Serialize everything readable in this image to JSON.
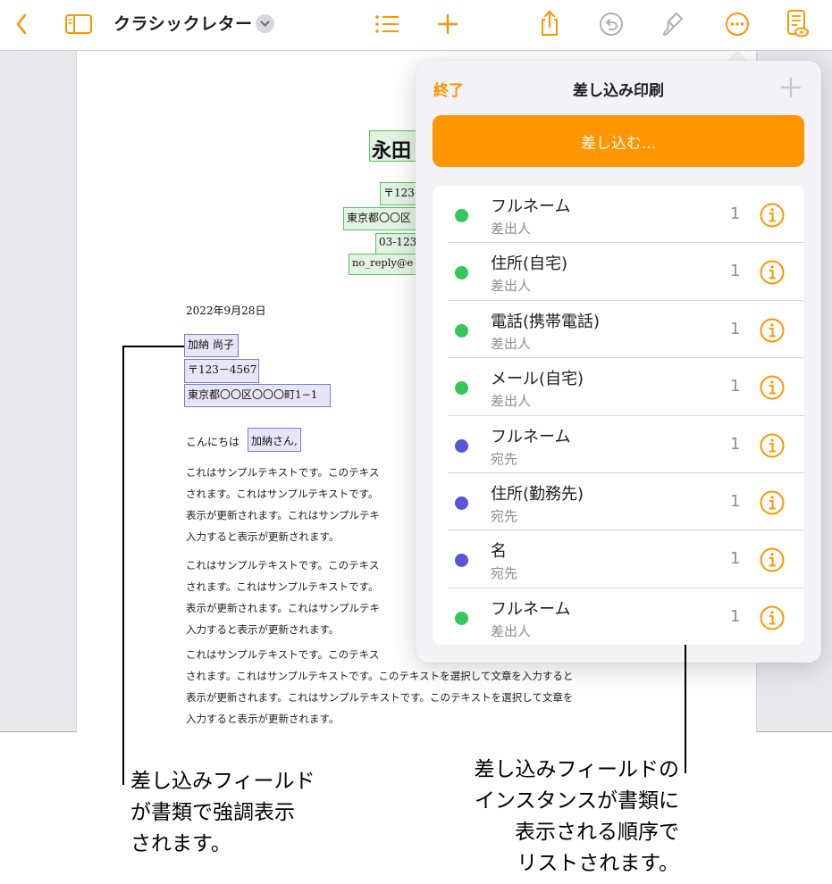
{
  "toolbar": {
    "back_icon": "chevron-left-icon",
    "sidebar_icon": "sidebar-icon",
    "title": "クラシックレター",
    "title_chevron_icon": "chevron-down-icon",
    "list_icon": "list-icon",
    "add_icon": "plus-icon",
    "share_icon": "share-icon",
    "undo_icon": "undo-icon",
    "format_icon": "paintbrush-icon",
    "more_icon": "ellipsis-circle-icon",
    "view_icon": "document-view-icon",
    "accent_color": "#ff9500"
  },
  "document": {
    "sender_name": "永田",
    "sender_postal": "〒123-",
    "sender_address": "東京都〇〇区",
    "sender_phone": "03-123",
    "sender_email": "no_reply@e",
    "date": "2022年9月28日",
    "recipient_name": "加納 尚子",
    "recipient_postal": "〒123－4567",
    "recipient_address": "東京都〇〇区〇〇〇町1−1",
    "greeting_prefix": "こんにちは",
    "greeting_field": "加納さん,",
    "paragraphs": [
      [
        "これはサンプルテキストです。このテキス",
        "されます。これはサンプルテキストです。",
        "表示が更新されます。これはサンプルテキ",
        "入力すると表示が更新されます。"
      ],
      [
        "これはサンプルテキストです。このテキス",
        "されます。これはサンプルテキストです。",
        "表示が更新されます。これはサンプルテキ",
        "入力すると表示が更新されます。"
      ],
      [
        "これはサンプルテキストです。このテキス",
        "されます。これはサンプルテキストです。このテキストを選択して文章を入力すると",
        "表示が更新されます。これはサンプルテキストです。このテキストを選択して文章を",
        "入力すると表示が更新されます。"
      ]
    ]
  },
  "popover": {
    "done_label": "終了",
    "title": "差し込み印刷",
    "add_icon": "plus-icon",
    "merge_button": "差し込む...",
    "colors": {
      "sender": "#34c759",
      "recipient": "#5856d6"
    },
    "fields": [
      {
        "label": "フルネーム",
        "source": "差出人",
        "count": "1",
        "kind": "sender"
      },
      {
        "label": "住所(自宅)",
        "source": "差出人",
        "count": "1",
        "kind": "sender"
      },
      {
        "label": "電話(携帯電話)",
        "source": "差出人",
        "count": "1",
        "kind": "sender"
      },
      {
        "label": "メール(自宅)",
        "source": "差出人",
        "count": "1",
        "kind": "sender"
      },
      {
        "label": "フルネーム",
        "source": "宛先",
        "count": "1",
        "kind": "recipient"
      },
      {
        "label": "住所(勤務先)",
        "source": "宛先",
        "count": "1",
        "kind": "recipient"
      },
      {
        "label": "名",
        "source": "宛先",
        "count": "1",
        "kind": "recipient"
      },
      {
        "label": "フルネーム",
        "source": "差出人",
        "count": "1",
        "kind": "sender"
      }
    ],
    "info_icon": "info-circle-icon"
  },
  "callouts": {
    "left": [
      "差し込みフィールド",
      "が書類で強調表示",
      "されます。"
    ],
    "right": [
      "差し込みフィールドの",
      "インスタンスが書類に",
      "表示される順序で",
      "リストされます。"
    ]
  }
}
